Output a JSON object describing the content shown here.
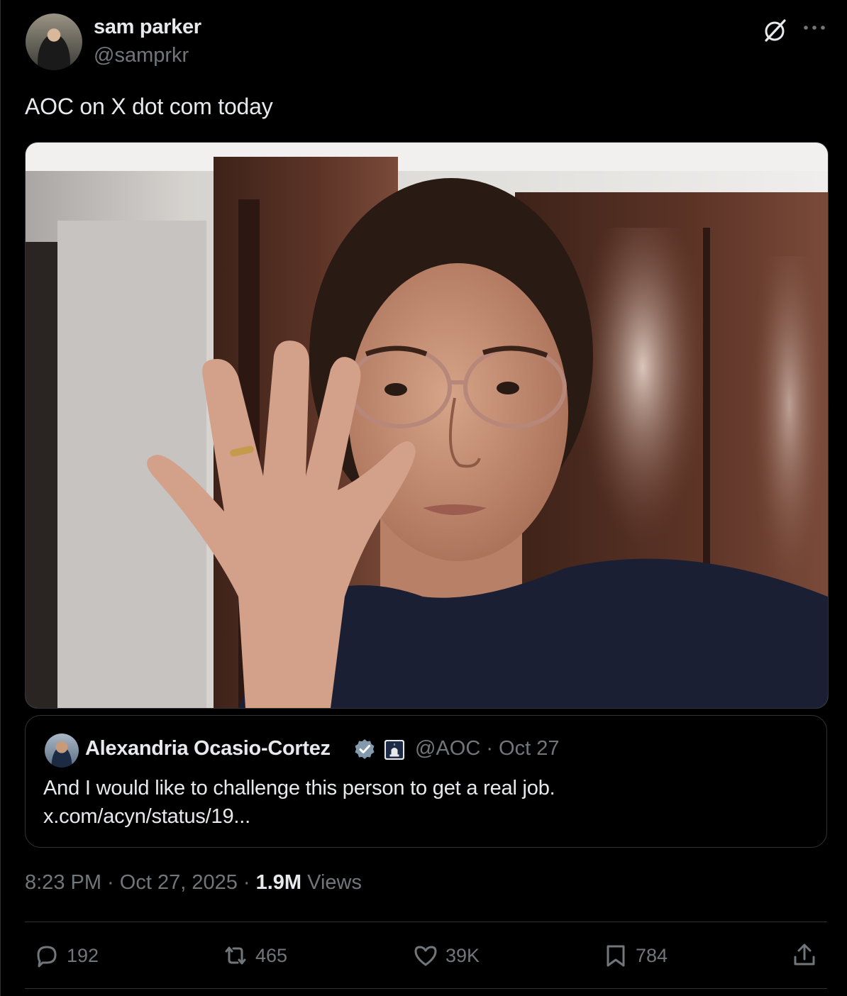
{
  "author": {
    "display_name": "sam parker",
    "handle": "@samprkr"
  },
  "tweet": {
    "text": "AOC on X dot com today"
  },
  "quote": {
    "name": "Alexandria Ocasio-Cortez",
    "meta": "@AOC · Oct 27",
    "text_line1": "And I would like to challenge this person to get a real job.",
    "text_line2": "x.com/acyn/status/19..."
  },
  "meta": {
    "time_date": "8:23 PM · Oct 27, 2025 · ",
    "views_count": "1.9M",
    "views_label": " Views"
  },
  "actions": {
    "replies": "192",
    "reposts": "465",
    "likes": "39K",
    "bookmarks": "784"
  },
  "icons": {
    "header": [
      "grok-icon",
      "more-icon"
    ],
    "quote": [
      "verified-badge-icon",
      "government-badge-icon"
    ],
    "actions": [
      "reply-icon",
      "repost-icon",
      "like-icon",
      "bookmark-icon",
      "share-icon"
    ]
  },
  "colors": {
    "background": "#000000",
    "text": "#e7e9ea",
    "secondary": "#71767b",
    "border": "#2f3336",
    "verified": "#829aab"
  }
}
